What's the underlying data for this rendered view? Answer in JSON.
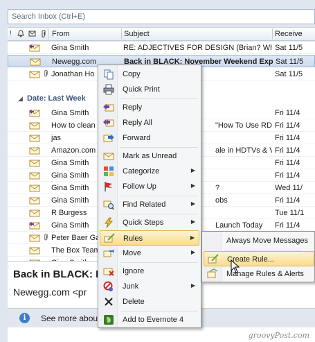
{
  "search": {
    "placeholder": "Search Inbox (Ctrl+E)"
  },
  "columns": {
    "from": "From",
    "subject": "Subject",
    "received": "Receive"
  },
  "group_label": "Date: Last Week",
  "messages_top": [
    {
      "from": "Gina Smith",
      "subject": "RE: ADJECTIVES FOR DESIGN (Brian? Wh...",
      "received": "Sat 11/5"
    },
    {
      "from": "Newegg.com",
      "subject": "Back in BLACK: November Weekend Exp...",
      "received": "Sat 11/5"
    },
    {
      "from": "Jonathan Ho",
      "subject": "",
      "received": "Sat 11/5"
    }
  ],
  "messages_week": [
    {
      "from": "Gina Smith",
      "subject": "",
      "received": "Fri 11/4"
    },
    {
      "from": "How to clean",
      "subject": "\"How To Use RD...",
      "received": "Fri 11/4"
    },
    {
      "from": "jas",
      "subject": "",
      "received": "Fri 11/4"
    },
    {
      "from": "Amazon.com",
      "subject": "ale in HDTVs & Vi...",
      "received": "Fri 11/4"
    },
    {
      "from": "Gina Smith",
      "subject": "",
      "received": "Fri 11/4"
    },
    {
      "from": "Gina Smith",
      "subject": "",
      "received": "Fri 11/4"
    },
    {
      "from": "Gina Smith",
      "subject": "?",
      "received": "Wed 11/"
    },
    {
      "from": "Gina Smith",
      "subject": "obs",
      "received": "Fri 11/4"
    },
    {
      "from": "R Burgess",
      "subject": "",
      "received": "Tue 11/1"
    },
    {
      "from": "Gina Smith",
      "subject": "Launch Today",
      "received": "Fri 11/4"
    },
    {
      "from": "Peter Baer Ga",
      "subject": "",
      "received": "Tue 11/1"
    },
    {
      "from": "The Box Team",
      "subject": "",
      "received": "Tue 11/1"
    },
    {
      "from": "Gina Smith",
      "subject": "",
      "received": "Tue 11/1"
    }
  ],
  "preview": {
    "title": "Back in BLACK: N",
    "from": "Newegg.com <pr"
  },
  "infobar": {
    "text": "See more about"
  },
  "context_menu": {
    "copy": "Copy",
    "quick_print": "Quick Print",
    "reply": "Reply",
    "reply_all": "Reply All",
    "forward": "Forward",
    "mark_unread": "Mark as Unread",
    "categorize": "Categorize",
    "follow_up": "Follow Up",
    "find_related": "Find Related",
    "quick_steps": "Quick Steps",
    "rules": "Rules",
    "move": "Move",
    "ignore": "Ignore",
    "junk": "Junk",
    "delete": "Delete",
    "evernote": "Add to Evernote 4"
  },
  "rules_submenu": {
    "always_move": "Always Move Messages",
    "create_rule": "Create Rule...",
    "manage_rules": "Manage Rules & Alerts"
  },
  "watermark": "groovyPost.com",
  "colors": {
    "selection": "#cfdbed",
    "menu_highlight": "#f9dc8c",
    "group_label": "#3d5478"
  }
}
